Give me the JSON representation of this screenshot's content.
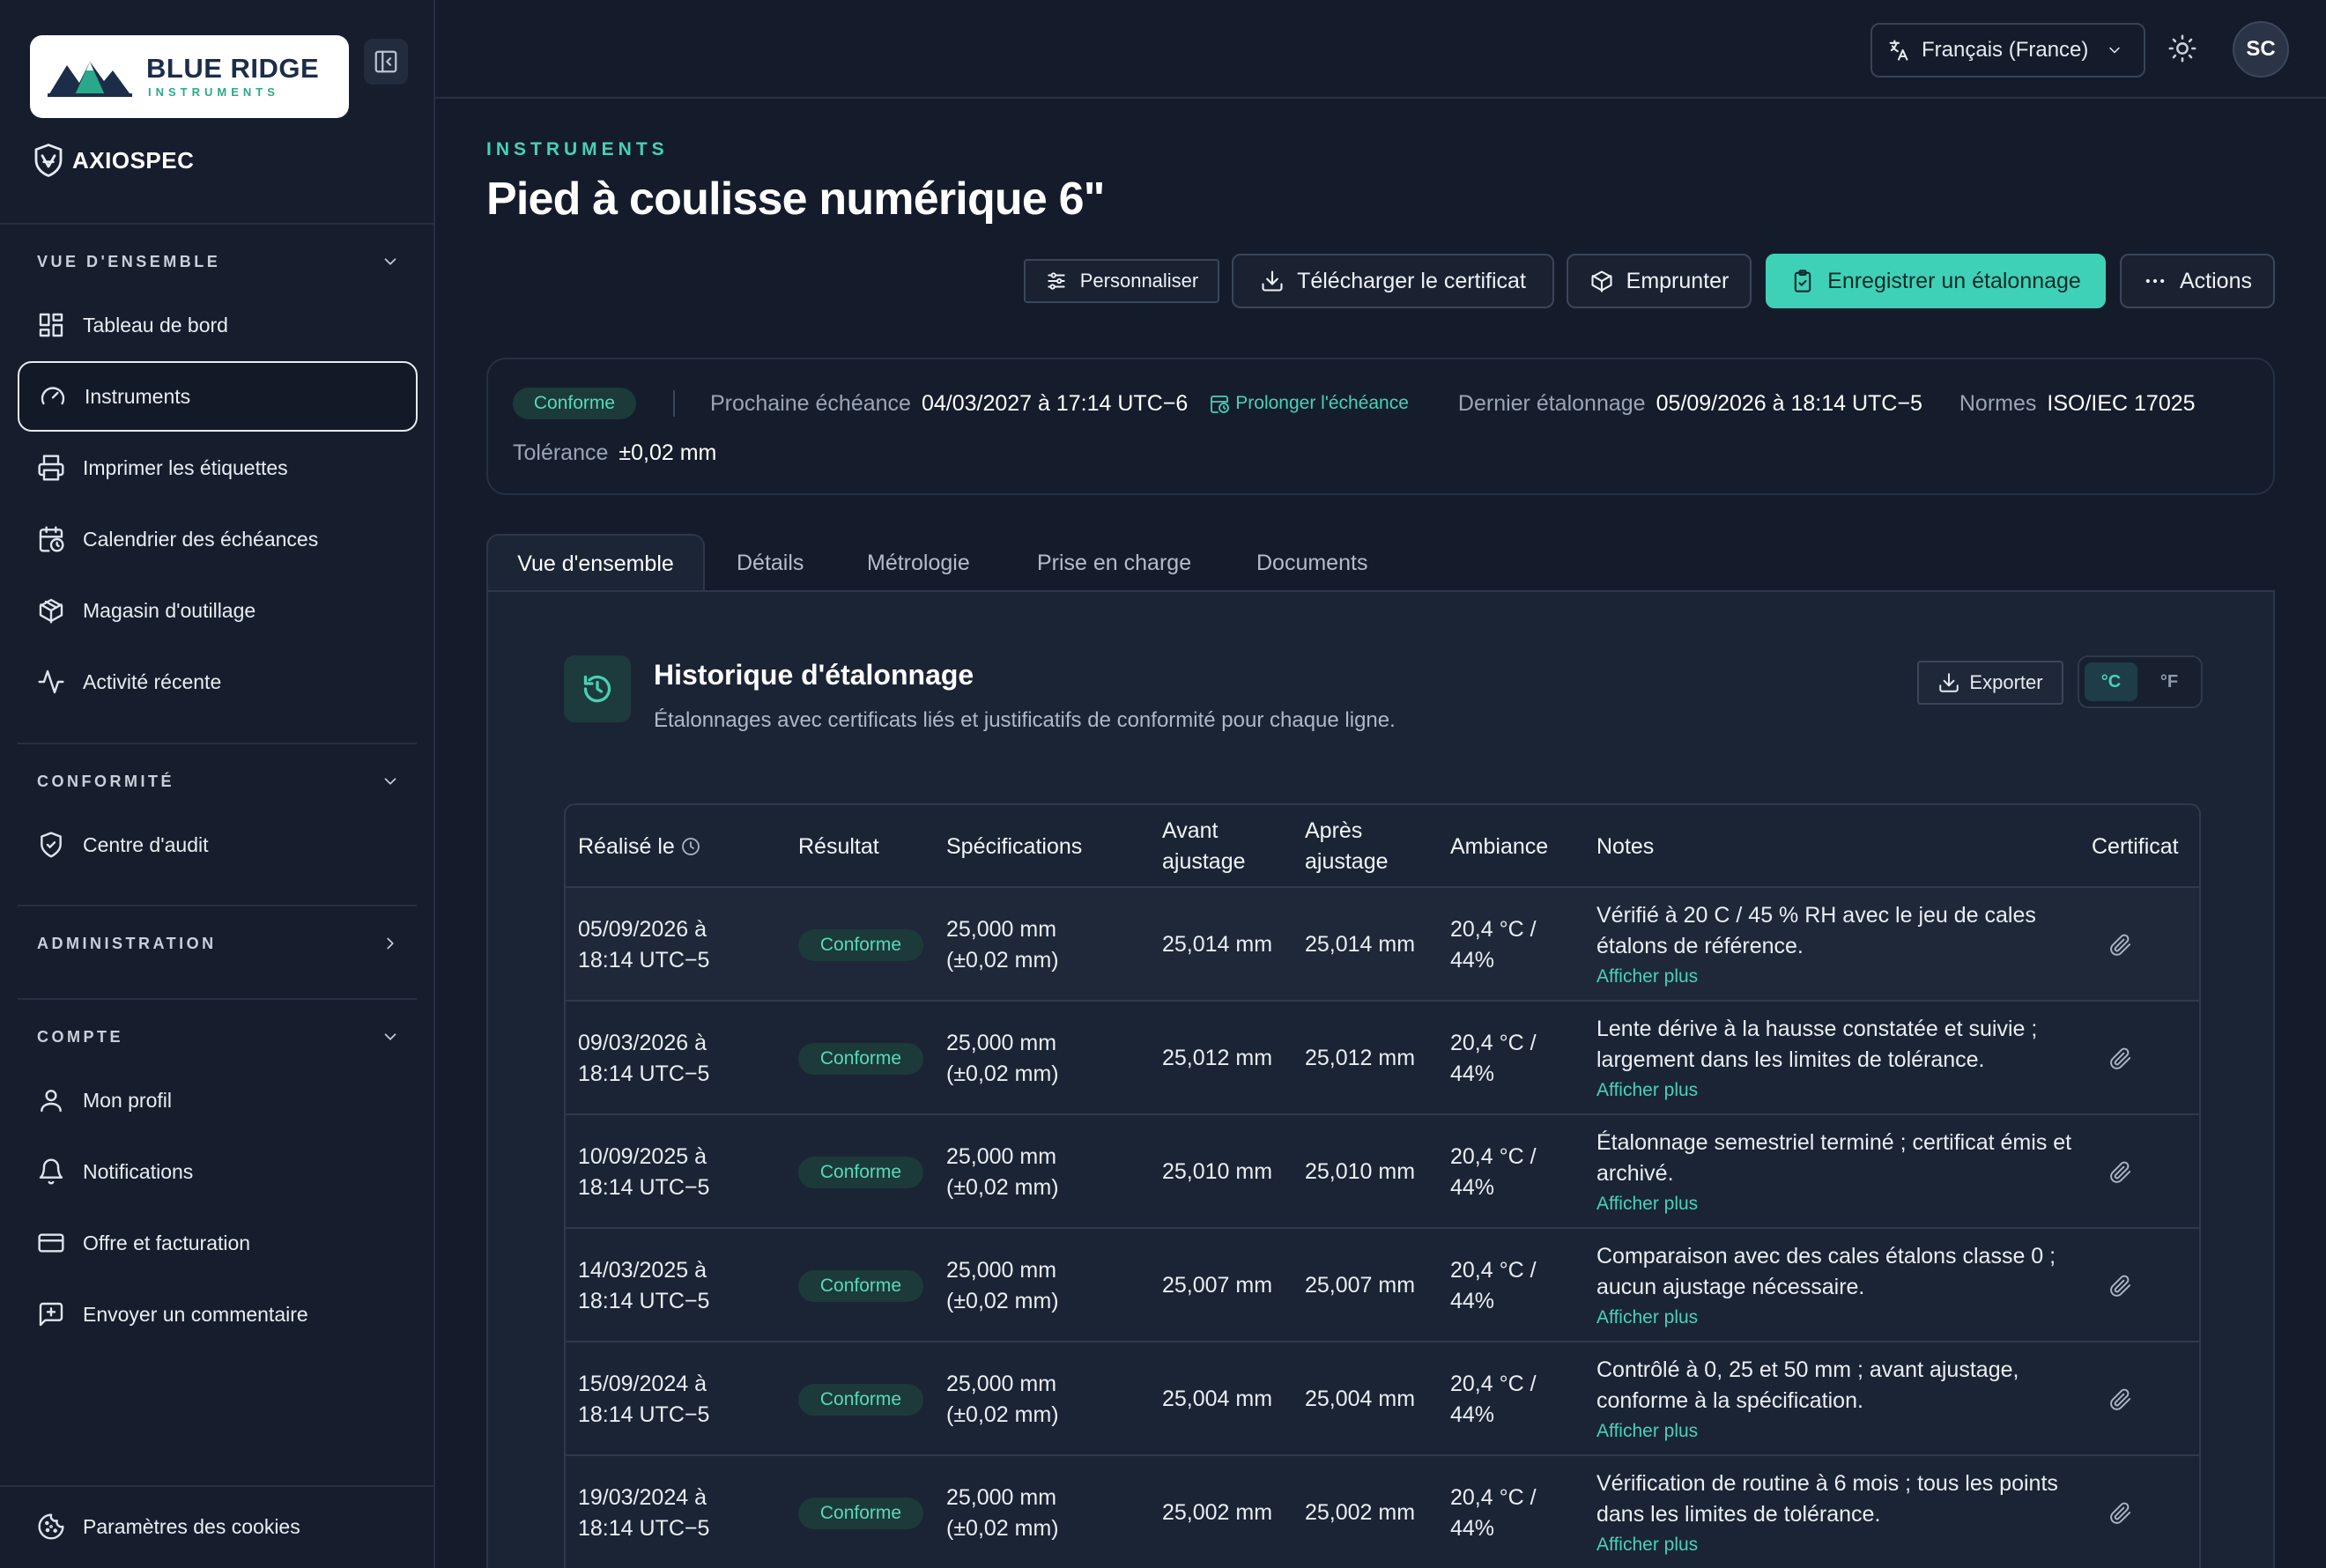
{
  "brand": {
    "name": "BLUE RIDGE",
    "sub": "INSTRUMENTS",
    "product": "AXIOSPEC"
  },
  "sidebar": {
    "sections": [
      {
        "title": "VUE D'ENSEMBLE",
        "expanded": true
      },
      {
        "title": "CONFORMITÉ",
        "expanded": true
      },
      {
        "title": "ADMINISTRATION",
        "expanded": false
      },
      {
        "title": "COMPTE",
        "expanded": true
      }
    ],
    "items": [
      {
        "label": "Tableau de bord",
        "icon": "dashboard-icon"
      },
      {
        "label": "Instruments",
        "icon": "gauge-icon",
        "active": true
      },
      {
        "label": "Imprimer les étiquettes",
        "icon": "printer-icon"
      },
      {
        "label": "Calendrier des échéances",
        "icon": "calendar-clock-icon"
      },
      {
        "label": "Magasin d'outillage",
        "icon": "package-icon"
      },
      {
        "label": "Activité récente",
        "icon": "activity-icon"
      },
      {
        "label": "Centre d'audit",
        "icon": "shield-check-icon"
      },
      {
        "label": "Mon profil",
        "icon": "user-icon"
      },
      {
        "label": "Notifications",
        "icon": "bell-icon"
      },
      {
        "label": "Offre et facturation",
        "icon": "credit-card-icon"
      },
      {
        "label": "Envoyer un commentaire",
        "icon": "message-plus-icon"
      }
    ],
    "footer": {
      "label": "Paramètres des cookies",
      "icon": "cookie-icon"
    }
  },
  "topbar": {
    "language": "Français (France)",
    "avatar": "SC"
  },
  "page": {
    "eyebrow": "INSTRUMENTS",
    "title": "Pied à coulisse numérique 6\"",
    "actions": {
      "customize": "Personnaliser",
      "download": "Télécharger le certificat",
      "borrow": "Emprunter",
      "record": "Enregistrer un étalonnage",
      "more": "Actions"
    }
  },
  "summary": {
    "status": "Conforme",
    "next_due_label": "Prochaine échéance",
    "next_due_value": "04/03/2027 à 17:14 UTC−6",
    "extend": "Prolonger l'échéance",
    "last_cal_label": "Dernier étalonnage",
    "last_cal_value": "05/09/2026 à 18:14 UTC−5",
    "standards_label": "Normes",
    "standards_value": "ISO/IEC 17025",
    "tolerance_label": "Tolérance",
    "tolerance_value": "±0,02 mm"
  },
  "tabs": [
    "Vue d'ensemble",
    "Détails",
    "Métrologie",
    "Prise en charge",
    "Documents"
  ],
  "history": {
    "title": "Historique d'étalonnage",
    "subtitle": "Étalonnages avec certificats liés et justificatifs de conformité pour chaque ligne.",
    "export": "Exporter",
    "unit_c": "°C",
    "unit_f": "°F",
    "columns": [
      "Réalisé le",
      "Résultat",
      "Spécifications",
      "Avant ajustage",
      "Après ajustage",
      "Ambiance",
      "Notes",
      "Certificat"
    ],
    "more_label": "Afficher plus",
    "rows": [
      {
        "date": "05/09/2026 à",
        "time": "18:14 UTC−5",
        "result": "Conforme",
        "spec1": "25,000 mm",
        "spec2": "(±0,02 mm)",
        "before": "25,014 mm",
        "after": "25,014 mm",
        "amb1": "20,4 °C /",
        "amb2": "44%",
        "notes": "Vérifié à 20 C / 45 % RH avec le jeu de cales étalons de référence."
      },
      {
        "date": "09/03/2026 à",
        "time": "18:14 UTC−5",
        "result": "Conforme",
        "spec1": "25,000 mm",
        "spec2": "(±0,02 mm)",
        "before": "25,012 mm",
        "after": "25,012 mm",
        "amb1": "20,4 °C /",
        "amb2": "44%",
        "notes": "Lente dérive à la hausse constatée et suivie ; largement dans les limites de tolérance."
      },
      {
        "date": "10/09/2025 à",
        "time": "18:14 UTC−5",
        "result": "Conforme",
        "spec1": "25,000 mm",
        "spec2": "(±0,02 mm)",
        "before": "25,010 mm",
        "after": "25,010 mm",
        "amb1": "20,4 °C /",
        "amb2": "44%",
        "notes": "Étalonnage semestriel terminé ; certificat émis et archivé."
      },
      {
        "date": "14/03/2025 à",
        "time": "18:14 UTC−5",
        "result": "Conforme",
        "spec1": "25,000 mm",
        "spec2": "(±0,02 mm)",
        "before": "25,007 mm",
        "after": "25,007 mm",
        "amb1": "20,4 °C /",
        "amb2": "44%",
        "notes": "Comparaison avec des cales étalons classe 0 ; aucun ajustage nécessaire."
      },
      {
        "date": "15/09/2024 à",
        "time": "18:14 UTC−5",
        "result": "Conforme",
        "spec1": "25,000 mm",
        "spec2": "(±0,02 mm)",
        "before": "25,004 mm",
        "after": "25,004 mm",
        "amb1": "20,4 °C /",
        "amb2": "44%",
        "notes": "Contrôlé à 0, 25 et 50 mm ; avant ajustage, conforme à la spécification."
      },
      {
        "date": "19/03/2024 à",
        "time": "18:14 UTC−5",
        "result": "Conforme",
        "spec1": "25,000 mm",
        "spec2": "(±0,02 mm)",
        "before": "25,002 mm",
        "after": "25,002 mm",
        "amb1": "20,4 °C /",
        "amb2": "44%",
        "notes": "Vérification de routine à 6 mois ; tous les points dans les limites de tolérance."
      }
    ]
  }
}
